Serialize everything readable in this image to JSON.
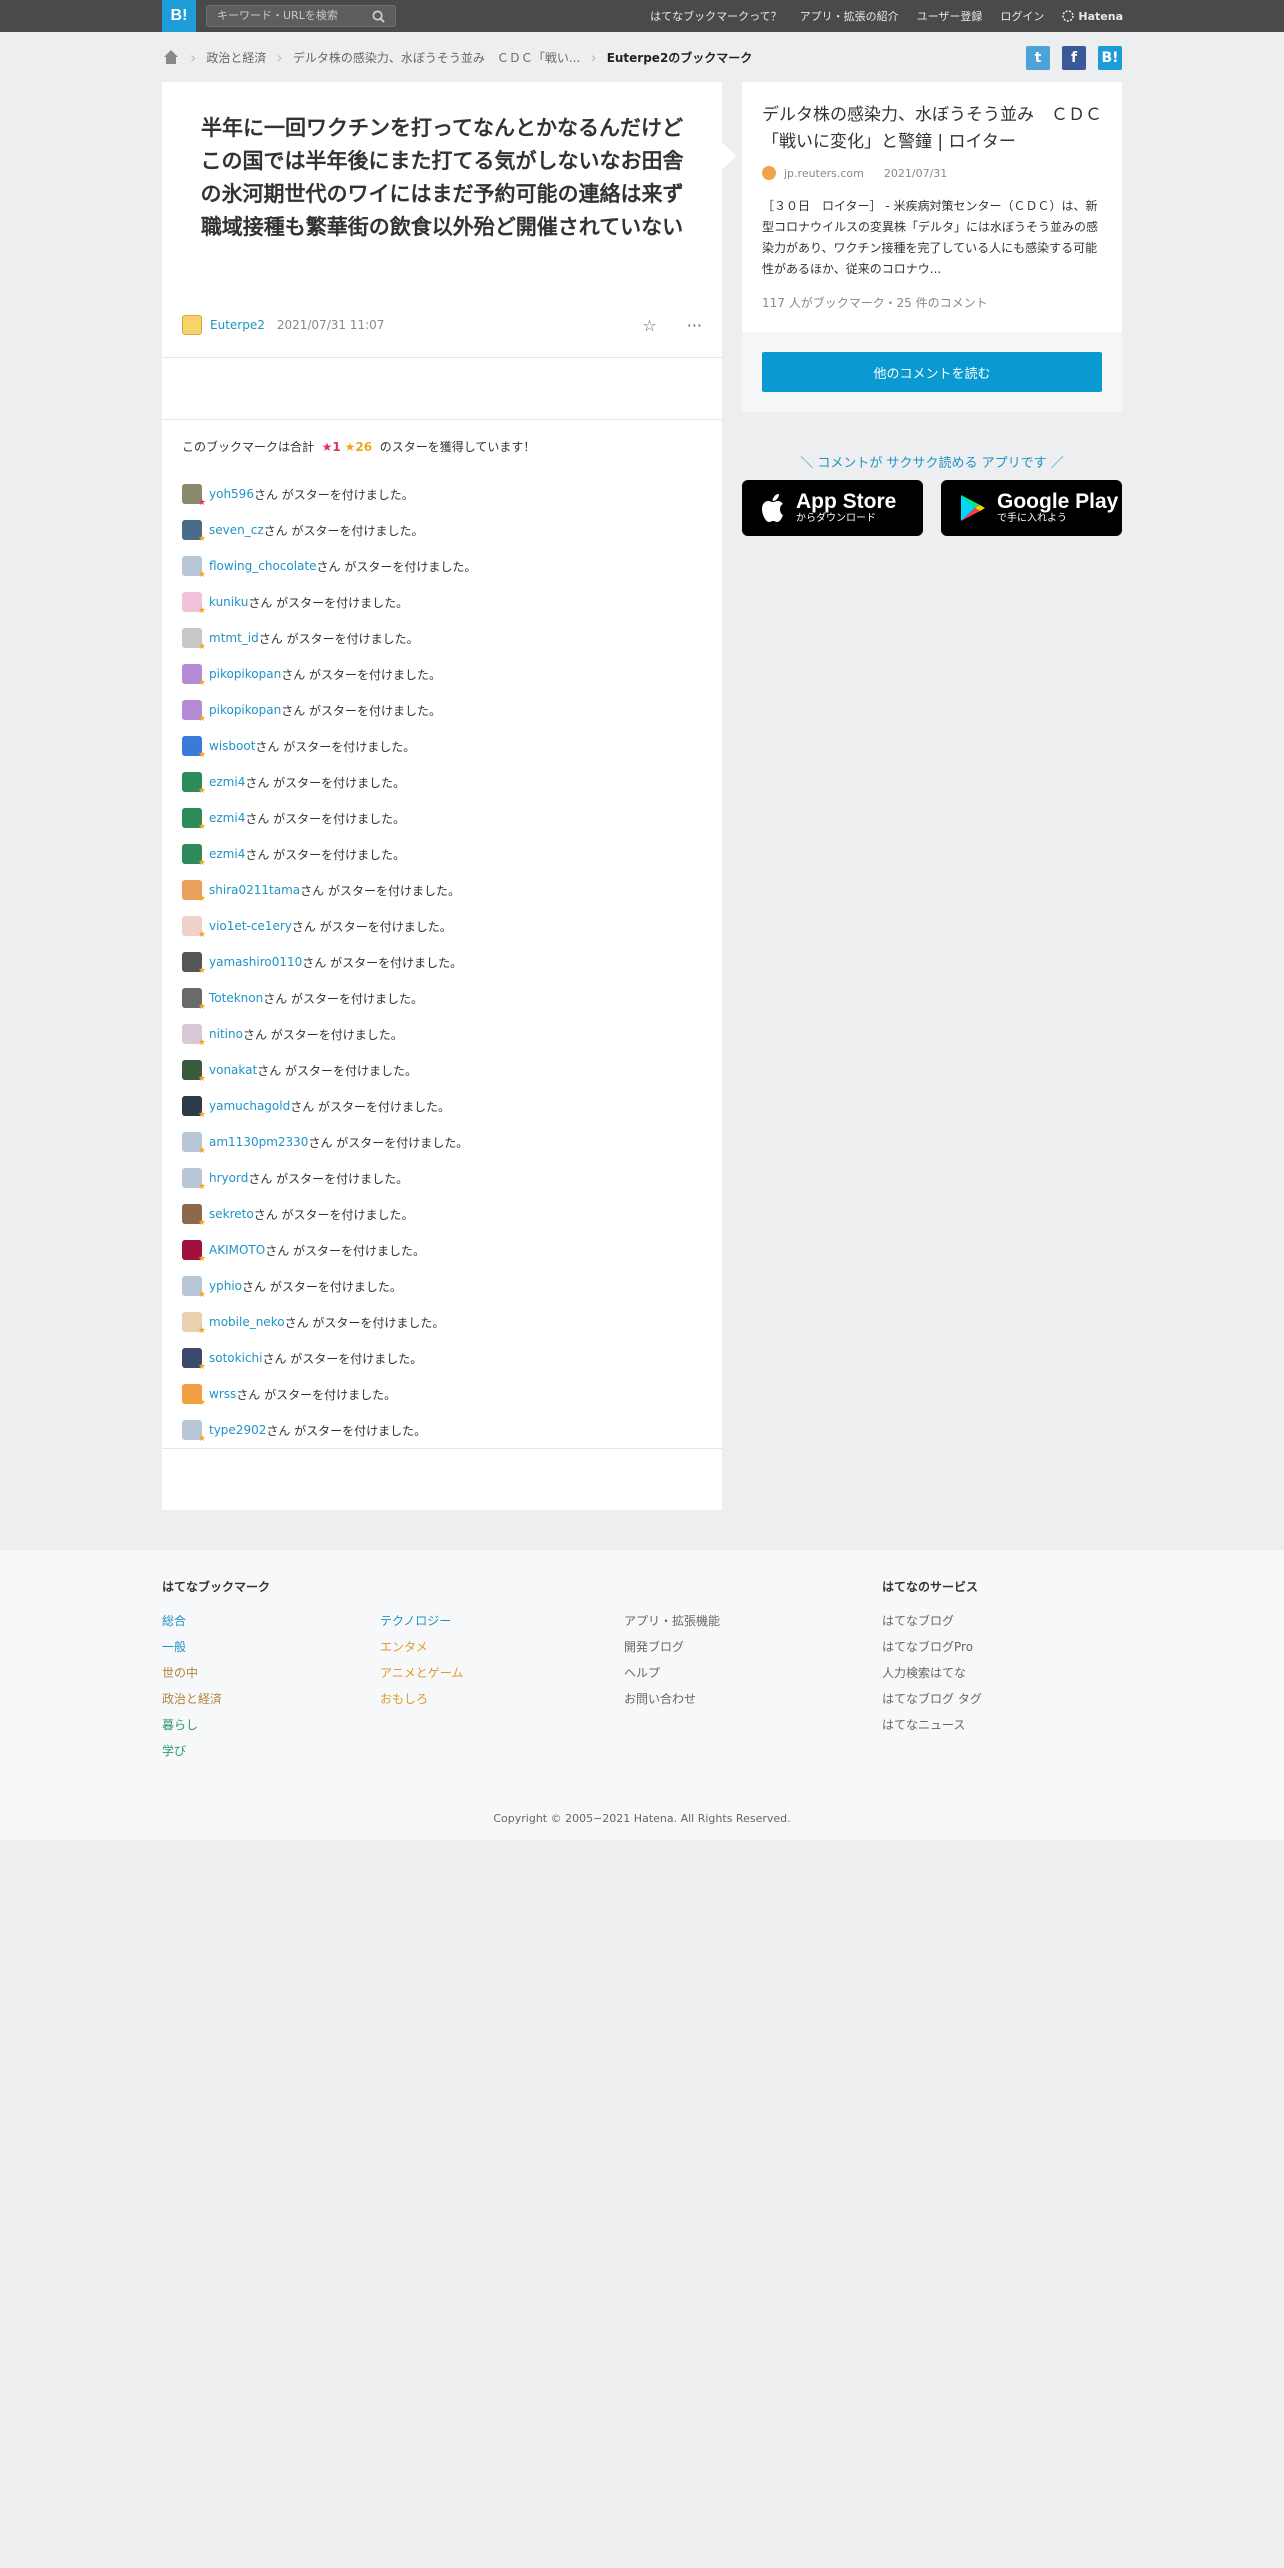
{
  "header": {
    "logo": "B!",
    "search_placeholder": "キーワード・URLを検索",
    "nav": [
      "はてなブックマークって？",
      "アプリ・拡張の紹介",
      "ユーザー登録",
      "ログイン"
    ],
    "brand": "Hatena"
  },
  "breadcrumb": {
    "items": [
      "政治と経済",
      "デルタ株の感染力、水ぼうそう並み　ＣＤＣ「戦い..."
    ],
    "current": "Euterpe2のブックマーク"
  },
  "share": {
    "twitter": "t",
    "facebook": "f",
    "hatena": "B!"
  },
  "bookmark": {
    "comment": "半年に一回ワクチンを打ってなんとかなるんだけどこの国では半年後にまた打てる気がしないなお田舎の氷河期世代のワイにはまだ予約可能の連絡は来ず職域接種も繁華街の飲食以外殆ど開催されていない",
    "user": "Euterpe2",
    "date": "2021/07/31 11:07",
    "star_icon": "☆",
    "more_icon": "···"
  },
  "stars": {
    "summary_prefix": "このブックマークは合計",
    "red_count": "★1",
    "gold_count": "★26",
    "summary_suffix": "のスターを獲得しています！",
    "suffix": "さん がスターを付けました。",
    "users": [
      "yoh596",
      "seven_cz",
      "flowing_chocolate",
      "kuniku",
      "mtmt_id",
      "pikopikopan",
      "pikopikopan",
      "wisboot",
      "ezmi4",
      "ezmi4",
      "ezmi4",
      "shira0211tama",
      "vio1et-ce1ery",
      "yamashiro0110",
      "Toteknon",
      "nitino",
      "vonakat",
      "yamuchagold",
      "am1130pm2330",
      "hryord",
      "sekreto",
      "AKIMOTO",
      "yphio",
      "mobile_neko",
      "sotokichi",
      "wrss",
      "type2902"
    ]
  },
  "entry": {
    "title": "デルタ株の感染力、水ぼうそう並み　ＣＤＣ「戦いに変化」と警鐘 | ロイター",
    "source": "jp.reuters.com",
    "date": "2021/07/31",
    "description": "［３０日　ロイター］ - 米疾病対策センター（ＣＤＣ）は、新型コロナウイルスの変異株「デルタ」には水ぼうそう並みの感染力があり、ワクチン接種を完了している人にも感染する可能性があるほか、従来のコロナウ...",
    "counts": "117 人がブックマーク・25 件のコメント",
    "read_button": "他のコメントを読む"
  },
  "app": {
    "promo": "＼ コメントが サクサク読める アプリです ／",
    "appstore_big": "App Store",
    "appstore_small": "からダウンロード",
    "googleplay_big": "Google Play",
    "googleplay_small": "で手に入れよう"
  },
  "footer": {
    "col1_title": "はてなブックマーク",
    "col1": [
      "総合",
      "一般",
      "世の中",
      "政治と経済",
      "暮らし",
      "学び"
    ],
    "col2": [
      "テクノロジー",
      "エンタメ",
      "アニメとゲーム",
      "おもしろ"
    ],
    "col3": [
      "アプリ・拡張機能",
      "開発ブログ",
      "ヘルプ",
      "お問い合わせ"
    ],
    "col4_title": "はてなのサービス",
    "col4": [
      "はてなブログ",
      "はてなブログPro",
      "人力検索はてな",
      "はてなブログ タグ",
      "はてなニュース"
    ],
    "copyright": "Copyright © 2005−2021 Hatena. All Rights Reserved."
  },
  "colors": {
    "accent": "#1c9dd8",
    "link": "#1f93c6",
    "star_red": "#e0335b",
    "star_gold": "#f2a61d",
    "category_green": "#2d9a6a",
    "category_orange": "#e09a2b",
    "category_brown": "#b08440"
  }
}
